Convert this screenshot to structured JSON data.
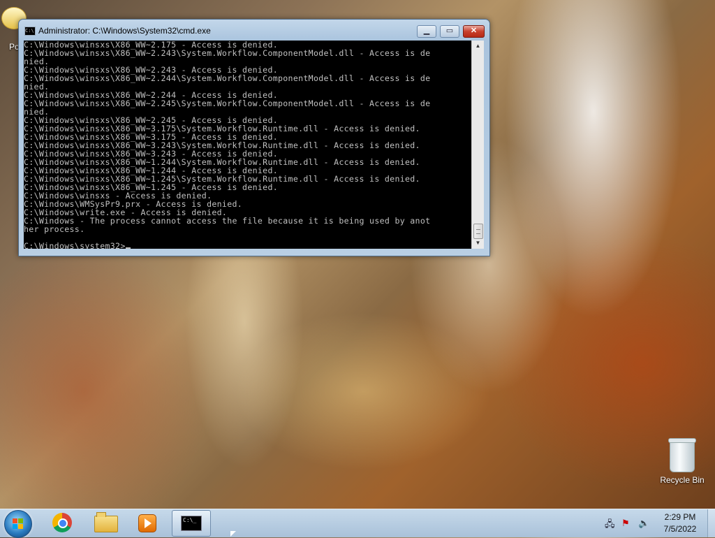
{
  "desktop": {
    "icons": [
      {
        "label": "Po"
      },
      {
        "label": "Recycle Bin"
      }
    ]
  },
  "window": {
    "title": "Administrator: C:\\Windows\\System32\\cmd.exe",
    "icon_text": "C:\\",
    "console_lines": [
      "C:\\Windows\\winsxs\\X86_WW~2.175 - Access is denied.",
      "C:\\Windows\\winsxs\\X86_WW~2.243\\System.Workflow.ComponentModel.dll - Access is de",
      "nied.",
      "C:\\Windows\\winsxs\\X86_WW~2.243 - Access is denied.",
      "C:\\Windows\\winsxs\\X86_WW~2.244\\System.Workflow.ComponentModel.dll - Access is de",
      "nied.",
      "C:\\Windows\\winsxs\\X86_WW~2.244 - Access is denied.",
      "C:\\Windows\\winsxs\\X86_WW~2.245\\System.Workflow.ComponentModel.dll - Access is de",
      "nied.",
      "C:\\Windows\\winsxs\\X86_WW~2.245 - Access is denied.",
      "C:\\Windows\\winsxs\\X86_WW~3.175\\System.Workflow.Runtime.dll - Access is denied.",
      "C:\\Windows\\winsxs\\X86_WW~3.175 - Access is denied.",
      "C:\\Windows\\winsxs\\X86_WW~3.243\\System.Workflow.Runtime.dll - Access is denied.",
      "C:\\Windows\\winsxs\\X86_WW~3.243 - Access is denied.",
      "C:\\Windows\\winsxs\\X86_WW~1.244\\System.Workflow.Runtime.dll - Access is denied.",
      "C:\\Windows\\winsxs\\X86_WW~1.244 - Access is denied.",
      "C:\\Windows\\winsxs\\X86_WW~1.245\\System.Workflow.Runtime.dll - Access is denied.",
      "C:\\Windows\\winsxs\\X86_WW~1.245 - Access is denied.",
      "C:\\Windows\\winsxs - Access is denied.",
      "C:\\Windows\\WMSysPr9.prx - Access is denied.",
      "C:\\Windows\\write.exe - Access is denied.",
      "C:\\Windows - The process cannot access the file because it is being used by anot",
      "her process.",
      ""
    ],
    "prompt": "C:\\Windows\\system32>"
  },
  "taskbar": {
    "buttons": [
      {
        "name": "start-button",
        "icon": "windows-logo-icon"
      },
      {
        "name": "chrome",
        "icon": "chrome-icon"
      },
      {
        "name": "file-explorer",
        "icon": "folder-icon"
      },
      {
        "name": "media-player",
        "icon": "media-player-icon"
      },
      {
        "name": "cmd",
        "icon": "cmd-icon",
        "icon_text": "C:\\_",
        "active": true
      }
    ],
    "clock": {
      "time": "2:29 PM",
      "date": "7/5/2022"
    }
  }
}
